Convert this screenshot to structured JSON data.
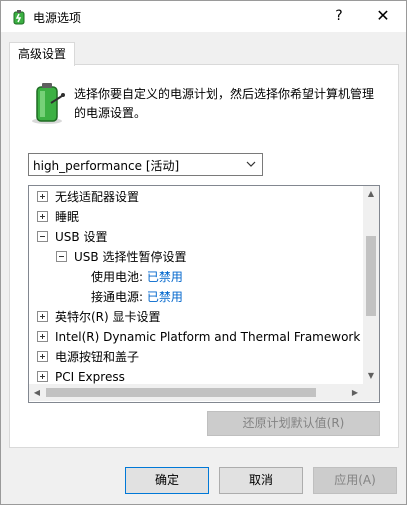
{
  "window": {
    "title": "电源选项",
    "help_glyph": "?",
    "close_glyph": "✕"
  },
  "tab": {
    "label": "高级设置"
  },
  "description": "选择你要自定义的电源计划，然后选择你希望计算机管理的电源设置。",
  "plan_select": {
    "value": "high_performance [活动]"
  },
  "tree": {
    "items": [
      {
        "label": "无线适配器设置"
      },
      {
        "label": "睡眠"
      },
      {
        "label": "USB 设置"
      },
      {
        "label": "USB 选择性暂停设置"
      },
      {
        "label": "使用电池:",
        "value": "已禁用"
      },
      {
        "label": "接通电源:",
        "value": "已禁用"
      },
      {
        "label": "英特尔(R) 显卡设置"
      },
      {
        "label": "Intel(R) Dynamic Platform and Thermal Framework Se"
      },
      {
        "label": "电源按钮和盖子"
      },
      {
        "label": "PCI Express"
      }
    ]
  },
  "restore_button": {
    "label": "还原计划默认值(R)"
  },
  "buttons": {
    "ok": "确定",
    "cancel": "取消",
    "apply": "应用(A)"
  },
  "colors": {
    "link_value": "#0066cc",
    "accent_border": "#0078d7",
    "battery_green": "#3cb043"
  }
}
